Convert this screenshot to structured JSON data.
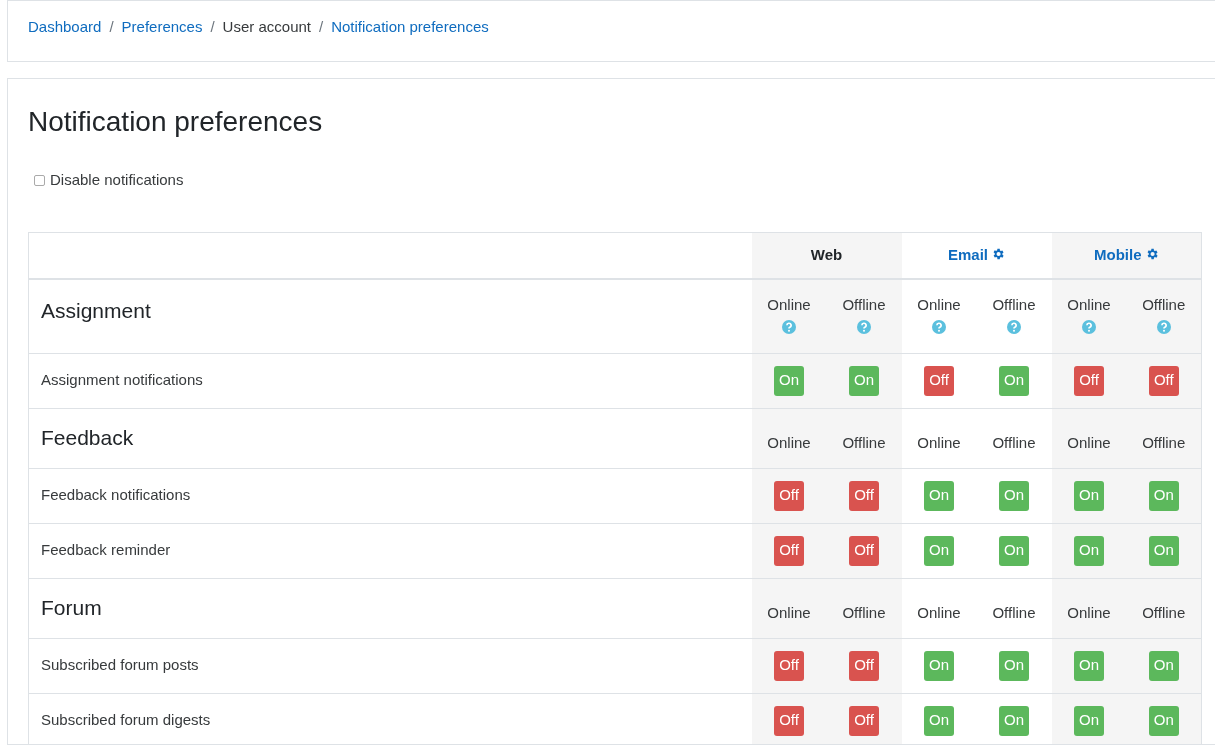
{
  "breadcrumb": [
    {
      "label": "Dashboard",
      "kind": "link"
    },
    {
      "label": "Preferences",
      "kind": "link"
    },
    {
      "label": "User account",
      "kind": "text"
    },
    {
      "label": "Notification preferences",
      "kind": "link"
    }
  ],
  "breadcrumb_separator": "/",
  "title": "Notification preferences",
  "disable_notifications": {
    "label": "Disable notifications",
    "checked": false
  },
  "processors": [
    {
      "name": "Web",
      "link": false,
      "settings": false
    },
    {
      "name": "Email",
      "link": true,
      "settings": true
    },
    {
      "name": "Mobile",
      "link": true,
      "settings": true
    }
  ],
  "sections": [
    {
      "title": "Assignment",
      "states": [
        {
          "label": "Online",
          "help": true
        },
        {
          "label": "Offline",
          "help": true
        },
        {
          "label": "Online",
          "help": true
        },
        {
          "label": "Offline",
          "help": true
        },
        {
          "label": "Online",
          "help": true
        },
        {
          "label": "Offline",
          "help": true
        }
      ],
      "rows": [
        {
          "label": "Assignment notifications",
          "toggles": [
            {
              "label": "On",
              "on": true
            },
            {
              "label": "On",
              "on": true
            },
            {
              "label": "Off",
              "on": false
            },
            {
              "label": "On",
              "on": true
            },
            {
              "label": "Off",
              "on": false
            },
            {
              "label": "Off",
              "on": false
            }
          ]
        }
      ]
    },
    {
      "title": "Feedback",
      "states": [
        {
          "label": "Online",
          "help": false
        },
        {
          "label": "Offline",
          "help": false
        },
        {
          "label": "Online",
          "help": false
        },
        {
          "label": "Offline",
          "help": false
        },
        {
          "label": "Online",
          "help": false
        },
        {
          "label": "Offline",
          "help": false
        }
      ],
      "rows": [
        {
          "label": "Feedback notifications",
          "toggles": [
            {
              "label": "Off",
              "on": false
            },
            {
              "label": "Off",
              "on": false
            },
            {
              "label": "On",
              "on": true
            },
            {
              "label": "On",
              "on": true
            },
            {
              "label": "On",
              "on": true
            },
            {
              "label": "On",
              "on": true
            }
          ]
        },
        {
          "label": "Feedback reminder",
          "toggles": [
            {
              "label": "Off",
              "on": false
            },
            {
              "label": "Off",
              "on": false
            },
            {
              "label": "On",
              "on": true
            },
            {
              "label": "On",
              "on": true
            },
            {
              "label": "On",
              "on": true
            },
            {
              "label": "On",
              "on": true
            }
          ]
        }
      ]
    },
    {
      "title": "Forum",
      "states": [
        {
          "label": "Online",
          "help": false
        },
        {
          "label": "Offline",
          "help": false
        },
        {
          "label": "Online",
          "help": false
        },
        {
          "label": "Offline",
          "help": false
        },
        {
          "label": "Online",
          "help": false
        },
        {
          "label": "Offline",
          "help": false
        }
      ],
      "rows": [
        {
          "label": "Subscribed forum posts",
          "toggles": [
            {
              "label": "Off",
              "on": false
            },
            {
              "label": "Off",
              "on": false
            },
            {
              "label": "On",
              "on": true
            },
            {
              "label": "On",
              "on": true
            },
            {
              "label": "On",
              "on": true
            },
            {
              "label": "On",
              "on": true
            }
          ]
        },
        {
          "label": "Subscribed forum digests",
          "toggles": [
            {
              "label": "Off",
              "on": false
            },
            {
              "label": "Off",
              "on": false
            },
            {
              "label": "On",
              "on": true
            },
            {
              "label": "On",
              "on": true
            },
            {
              "label": "On",
              "on": true
            },
            {
              "label": "On",
              "on": true
            }
          ]
        }
      ]
    }
  ]
}
